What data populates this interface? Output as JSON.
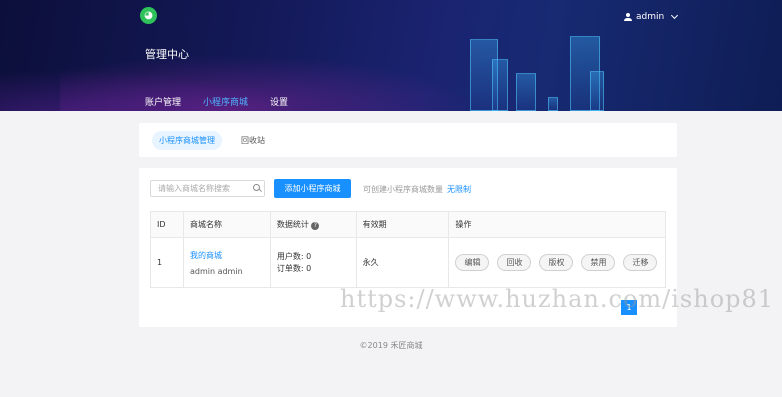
{
  "header": {
    "logo_glyph": "◕",
    "title": "管理中心",
    "user_name": "admin",
    "nav": [
      {
        "label": "账户管理",
        "active": false
      },
      {
        "label": "小程序商城",
        "active": true
      },
      {
        "label": "设置",
        "active": false
      }
    ]
  },
  "subtabs": [
    {
      "label": "小程序商城管理",
      "active": true
    },
    {
      "label": "回收站",
      "active": false
    }
  ],
  "toolbar": {
    "search_placeholder": "请输入商城名称搜索",
    "add_label": "添加小程序商城",
    "quota_label": "可创建小程序商城数量",
    "quota_value": "无限制"
  },
  "table": {
    "headers": [
      "ID",
      "商城名称",
      "数据统计",
      "有效期",
      "操作"
    ],
    "rows": [
      {
        "id": "1",
        "name": "我的商城",
        "owner": "admin admin",
        "users": "用户数: 0",
        "orders": "订单数: 0",
        "validity": "永久",
        "actions": [
          "编辑",
          "回收",
          "版权",
          "禁用",
          "迁移"
        ]
      }
    ]
  },
  "pagination": {
    "current": "1"
  },
  "footer": "©2019 禾匠商城",
  "watermark": "https://www.huzhan.com/ishop81",
  "colors": {
    "accent": "#1890ff",
    "header_bg": "#141a5a"
  }
}
